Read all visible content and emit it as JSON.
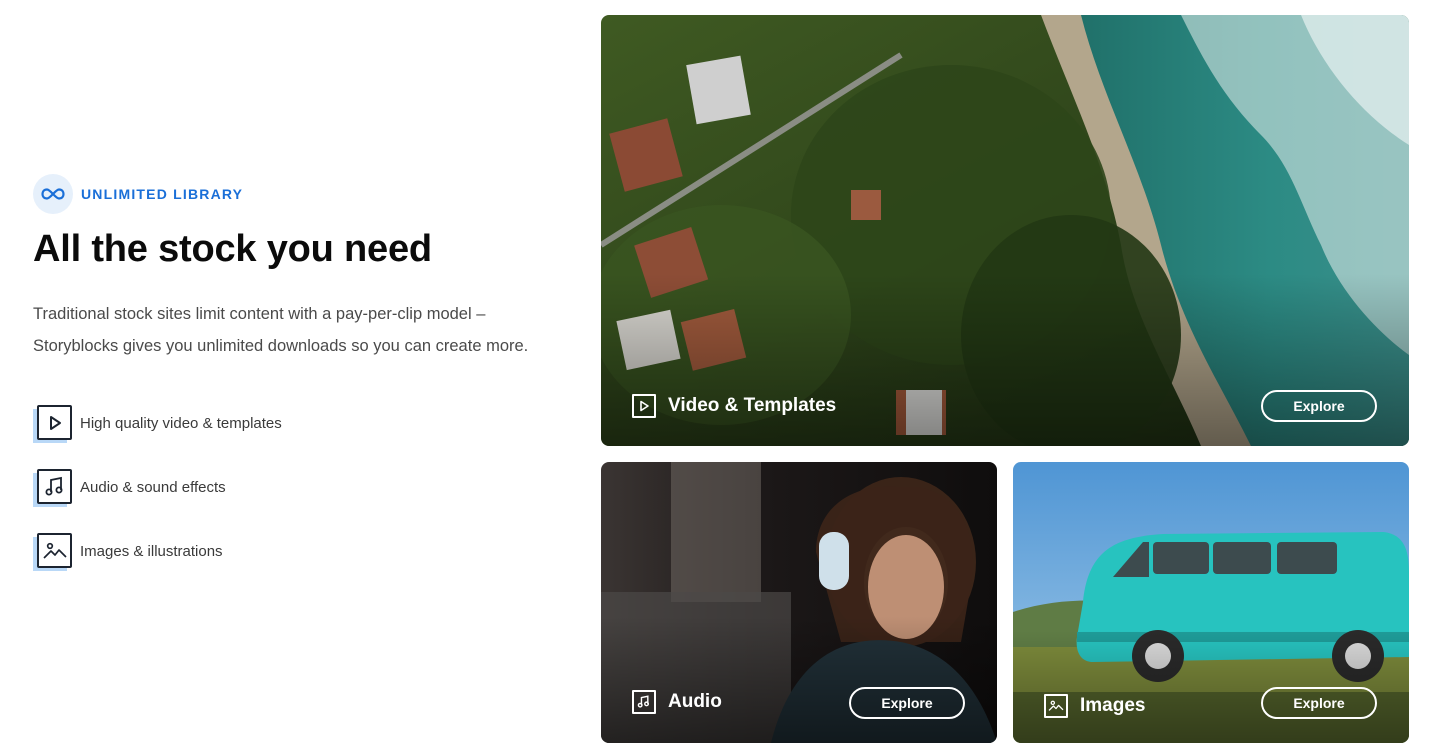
{
  "section": {
    "eyebrow": "UNLIMITED LIBRARY",
    "eyebrow_icon": "infinity-icon",
    "title": "All the stock you need",
    "description": "Traditional stock sites limit content with a pay-per-clip model – Storyblocks gives you unlimited downloads so you can create more.",
    "features": [
      {
        "label": "High quality video & templates",
        "icon": "play-icon"
      },
      {
        "label": "Audio & sound effects",
        "icon": "music-note-icon"
      },
      {
        "label": "Images & illustrations",
        "icon": "image-icon"
      }
    ]
  },
  "cards": {
    "video": {
      "title": "Video & Templates",
      "icon": "play-icon",
      "button": "Explore"
    },
    "audio": {
      "title": "Audio",
      "icon": "music-note-icon",
      "button": "Explore"
    },
    "images": {
      "title": "Images",
      "icon": "image-icon",
      "button": "Explore"
    }
  },
  "colors": {
    "accent": "#1a6fd8",
    "accent_bg": "#e6f0fb",
    "icon_shadow": "#b9d8f7",
    "heading": "#0b0b0b",
    "body_text": "#4a4a4a"
  }
}
